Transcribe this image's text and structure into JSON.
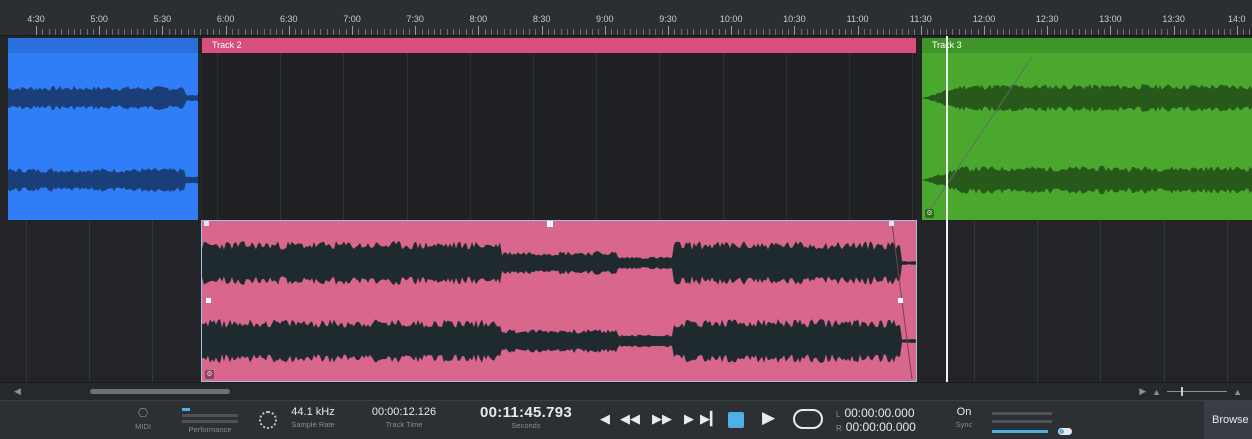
{
  "ruler": {
    "ticks": [
      "4:30",
      "5:00",
      "5:30",
      "6:00",
      "6:30",
      "7:00",
      "7:30",
      "8:00",
      "8:30",
      "9:00",
      "9:30",
      "10:00",
      "10:30",
      "11:00",
      "11:30",
      "12:00",
      "12:30",
      "13:00",
      "13:30",
      "14:0"
    ]
  },
  "tracks": {
    "clip1": {
      "label": "",
      "color": "#2f7ef7"
    },
    "clip2": {
      "label": "Track 2",
      "color": "#d74f7d"
    },
    "clip3": {
      "label": "Track 3",
      "color": "#4aa82e"
    },
    "clip4": {
      "label": "",
      "color": "#d9668c"
    }
  },
  "transport": {
    "midi_label": "MIDI",
    "performance_label": "Performance",
    "sample_rate_value": "44.1 kHz",
    "sample_rate_label": "Sample Rate",
    "track_time_value": "00:00:12.126",
    "track_time_label": "Track Time",
    "position_value": "00:11:45.793",
    "position_label": "Seconds",
    "left_key": "L",
    "left_value": "00:00:00.000",
    "right_key": "R",
    "right_value": "00:00:00.000",
    "sync_value": "On",
    "sync_label": "Sync",
    "browse_label": "Browse"
  },
  "colors": {
    "accent": "#4fb0e3",
    "background": "#222427"
  },
  "icons": {
    "rewind_start": "rewind-start-icon",
    "rewind": "rewind-icon",
    "fast_forward": "fast-forward-icon",
    "skip_end": "skip-end-icon",
    "stop": "stop-icon",
    "play": "play-icon",
    "loop": "loop-icon",
    "midi": "midi-icon",
    "performance": "performance-icon"
  }
}
